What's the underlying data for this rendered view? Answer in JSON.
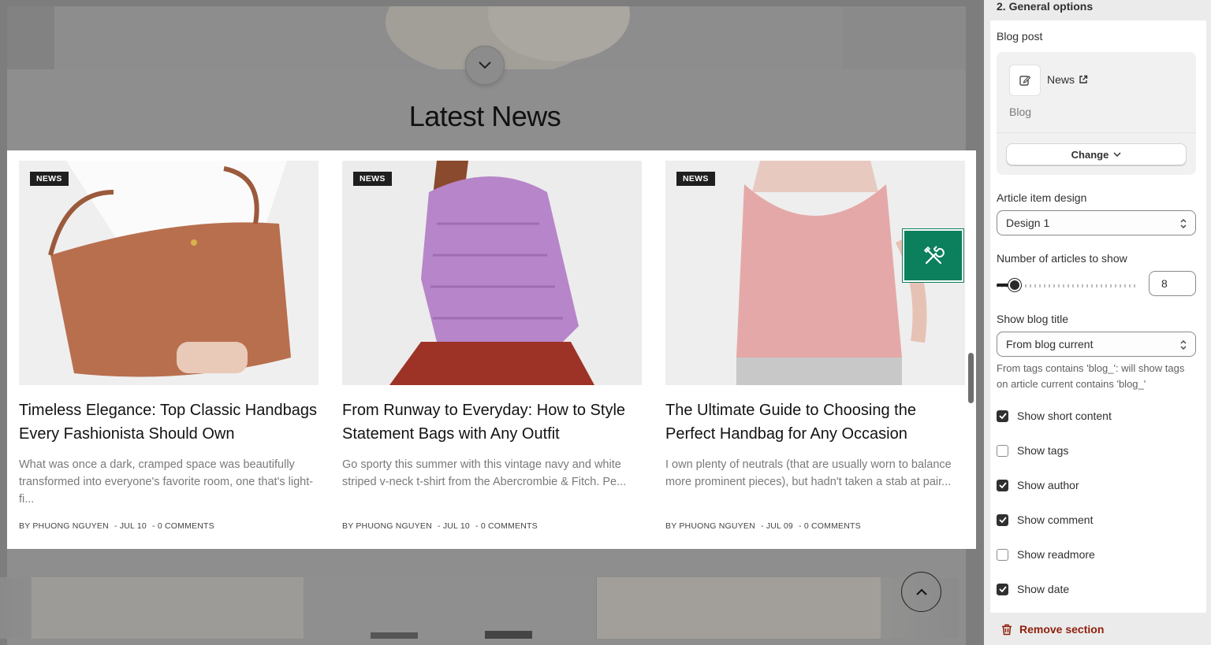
{
  "preview": {
    "section_title": "Latest News",
    "articles": [
      {
        "badge": "NEWS",
        "title": "Timeless Elegance: Top Classic Handbags Every Fashionista Should Own",
        "excerpt": "What was once a dark, cramped space was beautifully transformed into everyone's favorite room, one that's light-fi...",
        "author": "BY PHUONG NGUYEN",
        "date": "- JUL 10",
        "comments": "- 0 COMMENTS"
      },
      {
        "badge": "NEWS",
        "title": "From Runway to Everyday: How to Style Statement Bags with Any Outfit",
        "excerpt": "Go sporty this summer with this vintage navy and white striped v-neck t-shirt from the Abercrombie & Fitch. Pe...",
        "author": "BY PHUONG NGUYEN",
        "date": "- JUL 10",
        "comments": "- 0 COMMENTS"
      },
      {
        "badge": "NEWS",
        "title": "The Ultimate Guide to Choosing the Perfect Handbag for Any Occasion",
        "excerpt": "I own plenty of neutrals (that are usually worn to balance more prominent pieces), but hadn't taken a stab at pair...",
        "author": "BY PHUONG NGUYEN",
        "date": "- JUL 09",
        "comments": "- 0 COMMENTS"
      }
    ]
  },
  "panel": {
    "heading": "2. General options",
    "blog_post_label": "Blog post",
    "blog_name": "News",
    "blog_type": "Blog",
    "change_label": "Change",
    "article_design_label": "Article item design",
    "article_design_value": "Design 1",
    "articles_count_label": "Number of articles to show",
    "articles_count_value": "8",
    "articles_count_level": 8,
    "blog_title_label": "Show blog title",
    "blog_title_value": "From blog current",
    "blog_title_help": "From tags contains 'blog_': will show tags on article current contains 'blog_'",
    "checkboxes": [
      {
        "label": "Show short content",
        "checked": true
      },
      {
        "label": "Show tags",
        "checked": false
      },
      {
        "label": "Show author",
        "checked": true
      },
      {
        "label": "Show comment",
        "checked": true
      },
      {
        "label": "Show readmore",
        "checked": false
      },
      {
        "label": "Show date",
        "checked": true
      }
    ],
    "remove_label": "Remove section"
  },
  "colors": {
    "accent_green": "#0c7f5d",
    "danger": "#8e1f0b"
  }
}
